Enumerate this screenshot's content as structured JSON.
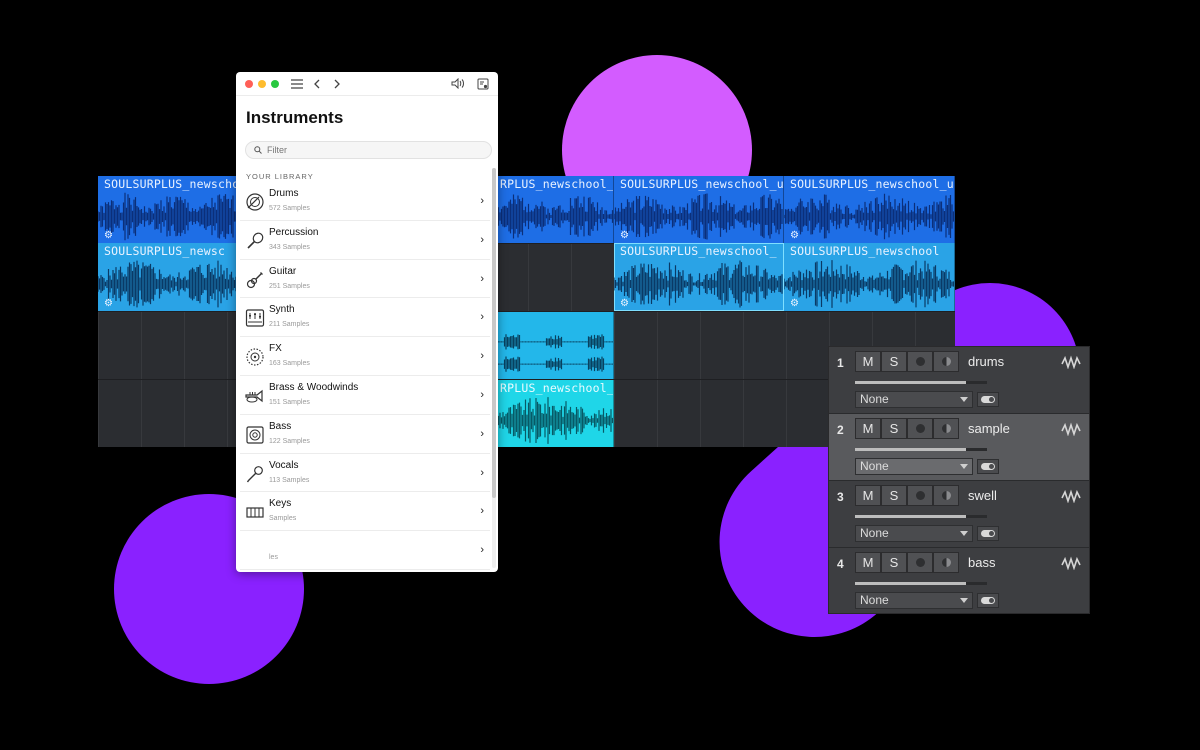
{
  "colors": {
    "pink_circle": "#d35cff",
    "purple": "#8a21ff",
    "clip_blue": "#1e6ee6",
    "clip_cyan": "#2aa3e6",
    "clip_aqua": "#1fd6e8",
    "mixer_bg": "#3d3e41"
  },
  "timeline": {
    "clips": [
      {
        "title": "SOULSURPLUS_newschool_u"
      },
      {
        "title": "RPLUS_newschool_u"
      },
      {
        "title": "SOULSURPLUS_newschool_u"
      },
      {
        "title": "SOULSURPLUS_newschool_u"
      },
      {
        "title": "SOULSURPLUS_newsc"
      },
      {
        "title": "SOULSURPLUS_newschool_"
      },
      {
        "title": "SOULSURPLUS_newschool"
      },
      {
        "title": ""
      },
      {
        "title": "RPLUS_newschool_"
      }
    ]
  },
  "panel": {
    "title": "Instruments",
    "filter_placeholder": "Filter",
    "section_label": "YOUR LIBRARY",
    "items": [
      {
        "name": "Drums",
        "count": "572 Samples",
        "icon": "drum-icon"
      },
      {
        "name": "Percussion",
        "count": "343 Samples",
        "icon": "maraca-icon"
      },
      {
        "name": "Guitar",
        "count": "251 Samples",
        "icon": "guitar-icon"
      },
      {
        "name": "Synth",
        "count": "211 Samples",
        "icon": "synth-icon"
      },
      {
        "name": "FX",
        "count": "163 Samples",
        "icon": "fx-icon"
      },
      {
        "name": "Brass & Woodwinds",
        "count": "151 Samples",
        "icon": "trumpet-icon"
      },
      {
        "name": "Bass",
        "count": "122 Samples",
        "icon": "speaker-icon"
      },
      {
        "name": "Vocals",
        "count": "113 Samples",
        "icon": "microphone-icon"
      },
      {
        "name": "Keys",
        "count": "Samples",
        "icon": "piano-icon"
      },
      {
        "name": "",
        "count": "les",
        "icon": "more-icon"
      }
    ]
  },
  "mixer": {
    "tracks": [
      {
        "num": "1",
        "name": "drums",
        "mute": "M",
        "solo": "S",
        "input": "None",
        "level": 0.84,
        "selected": false
      },
      {
        "num": "2",
        "name": "sample",
        "mute": "M",
        "solo": "S",
        "input": "None",
        "level": 0.84,
        "selected": true
      },
      {
        "num": "3",
        "name": "swell",
        "mute": "M",
        "solo": "S",
        "input": "None",
        "level": 0.84,
        "selected": false
      },
      {
        "num": "4",
        "name": "bass",
        "mute": "M",
        "solo": "S",
        "input": "None",
        "level": 0.84,
        "selected": false
      }
    ]
  }
}
